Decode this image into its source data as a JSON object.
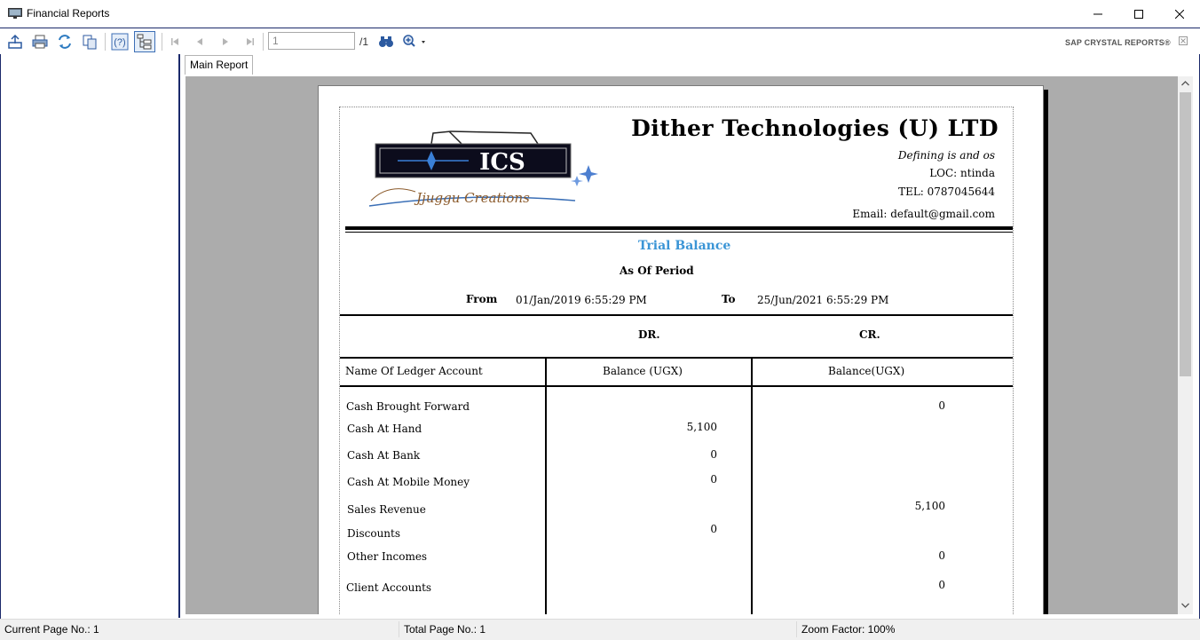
{
  "window": {
    "title": "Financial Reports",
    "icon": "monitor-icon"
  },
  "toolbar": {
    "buttons": [
      "export-icon",
      "print-icon",
      "refresh-icon",
      "copy-icon",
      "help-icon",
      "group-tree-icon",
      "first-page-icon",
      "prev-page-icon",
      "next-page-icon",
      "last-page-icon",
      "find-icon",
      "zoom-icon"
    ],
    "page_input": "1",
    "page_total": "/1",
    "brand": "SAP CRYSTAL REPORTS®"
  },
  "tabs": {
    "main_label": "Main Report"
  },
  "report": {
    "company": "Dither Technologies (U) LTD",
    "motto": "Defining is and os",
    "location": "LOC: ntinda",
    "tel": "TEL: 0787045644",
    "email": "Email: default@gmail.com",
    "logo_text": "ICS",
    "logo_script": "Jjuggu Creations",
    "title": "Trial Balance",
    "subtitle": "As Of Period",
    "from_label": "From",
    "from_value": "01/Jan/2019 6:55:29 PM",
    "to_label": "To",
    "to_value": "25/Jun/2021 6:55:29 PM",
    "dr_label": "DR.",
    "cr_label": "CR.",
    "col_account": "Name Of Ledger Account",
    "col_dr": "Balance (UGX)",
    "col_cr": "Balance(UGX)",
    "rows": [
      {
        "account": "Cash Brought Forward",
        "dr": "",
        "cr": "0"
      },
      {
        "account": "Cash At Hand",
        "dr": "5,100",
        "cr": ""
      },
      {
        "account": "Cash At Bank",
        "dr": "0",
        "cr": ""
      },
      {
        "account": "Cash At Mobile Money",
        "dr": "0",
        "cr": ""
      },
      {
        "account": "Sales Revenue",
        "dr": "",
        "cr": "5,100"
      },
      {
        "account": "Discounts",
        "dr": "0",
        "cr": ""
      },
      {
        "account": "Other Incomes",
        "dr": "",
        "cr": "0"
      },
      {
        "account": "Client Accounts",
        "dr": "",
        "cr": "0"
      }
    ]
  },
  "status": {
    "current_page": "Current Page No.: 1",
    "total_pages": "Total Page No.: 1",
    "zoom": "Zoom Factor: 100%"
  }
}
